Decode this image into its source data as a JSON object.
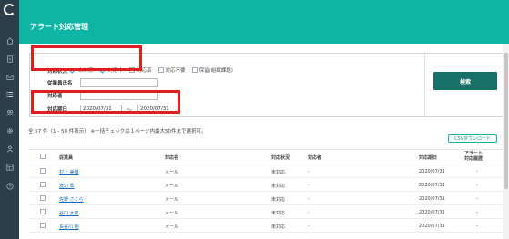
{
  "header": {
    "title": "アラート対応管理"
  },
  "sidebar": {
    "icons": [
      "logo-icon",
      "home-icon",
      "document-icon",
      "mail-icon",
      "list-icon",
      "users-icon",
      "gear-icon",
      "user-group-icon",
      "layout-icon",
      "help-icon"
    ]
  },
  "search": {
    "status_label": "対応状況",
    "statuses": [
      {
        "label": "未対応",
        "checked": true
      },
      {
        "label": "対応中",
        "checked": true
      },
      {
        "label": "対応済",
        "checked": false
      },
      {
        "label": "対応不要",
        "checked": false
      },
      {
        "label": "保留(組織課題)",
        "checked": false
      }
    ],
    "employee_label": "従業員氏名",
    "handler_label": "対応者",
    "date_label": "対応期日",
    "date_from": "2020/07/31",
    "date_to": "2020/07/31",
    "tilde": "～",
    "search_button": "検索"
  },
  "results": {
    "count_text": "全 57 件（1 - 50 件表示） ※一括チェックは１ページ内最大50件まで選択可。",
    "csv_button": "CSVダウンロード"
  },
  "table": {
    "headers": {
      "employee": "従業員",
      "alert_name": "対応名",
      "status": "対応状況",
      "handler": "対応者",
      "due_date": "対応期日",
      "history": "アラート\n対応履歴"
    },
    "rows": [
      {
        "employee": "村上 美優",
        "alert_name": "メール",
        "status": "未対応",
        "handler": "-",
        "due_date": "2020/07/31",
        "history": "-"
      },
      {
        "employee": "渡辺 翠",
        "alert_name": "メール",
        "status": "未対応",
        "handler": "-",
        "due_date": "2020/07/31",
        "history": "-"
      },
      {
        "employee": "佐野 さくら",
        "alert_name": "メール",
        "status": "未対応",
        "handler": "-",
        "due_date": "2020/07/31",
        "history": "-"
      },
      {
        "employee": "谷口 太郎",
        "alert_name": "メール",
        "status": "未対応",
        "handler": "-",
        "due_date": "2020/07/31",
        "history": "-"
      },
      {
        "employee": "長谷川 翔",
        "alert_name": "メール",
        "status": "未対応",
        "handler": "-",
        "due_date": "2020/07/31",
        "history": "-"
      }
    ]
  },
  "colors": {
    "header": "#0fb5a4",
    "sidebar": "#2d3e4b",
    "search_button": "#177166",
    "highlight": "#e01e1e"
  }
}
